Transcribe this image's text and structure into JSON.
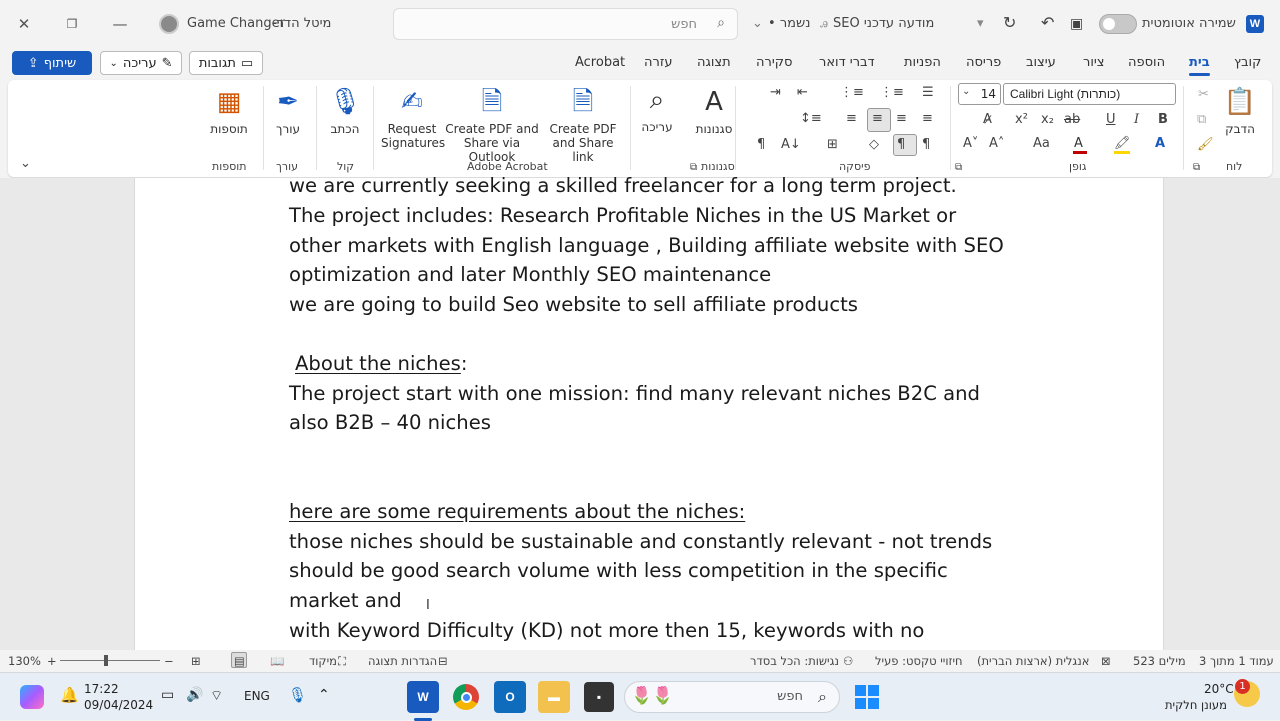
{
  "titlebar": {
    "doc_name": "Game Changer",
    "author": "-מיטל הדר",
    "search_placeholder": "חפש",
    "sensitivity": "SEO מודעה עדכני",
    "saved_state": "• נשמר",
    "autosave_label": "שמירה אוטומטית"
  },
  "actions": {
    "share": "שיתוף",
    "editing": "עריכה",
    "comments": "תגובות"
  },
  "tabs": [
    "קובץ",
    "בית",
    "הוספה",
    "ציור",
    "עיצוב",
    "פריסה",
    "הפניות",
    "דברי דואר",
    "סקירה",
    "תצוגה",
    "עזרה",
    "Acrobat"
  ],
  "active_tab": "בית",
  "ribbon": {
    "groups": {
      "clipboard": "לוח",
      "font": "גופן",
      "paragraph": "פיסקה",
      "styles": "סגנונות",
      "acrobat": "Adobe Acrobat",
      "voice": "קול",
      "editor": "עורך",
      "addins": "תוספות"
    },
    "paste": "הדבק",
    "font_name": "Calibri Light (כותרות)",
    "font_size": "14",
    "styles_btn": "סגנונות",
    "editing_btn": "עריכה",
    "create_pdf_link_1": "Create PDF",
    "create_pdf_link_2": "and Share link",
    "create_pdf_outlook_1": "Create PDF and",
    "create_pdf_outlook_2": "Share via Outlook",
    "request_sig_1": "Request",
    "request_sig_2": "Signatures",
    "dictate": "הכתב",
    "editor_btn": "עורך",
    "addins_btn": "תוספות"
  },
  "document": {
    "line1": "we are currently seeking a skilled freelancer for a long term project.",
    "line2": "The  project includes: Research Profitable Niches in the US Market or",
    "line3": "other markets with English language , Building affiliate  website with SEO",
    "line4": "optimization and later Monthly SEO maintenance",
    "line5": "we are going to build Seo website to sell affiliate products",
    "heading_niches": "About the niches",
    "heading_colon": ":",
    "line6": "The project start with one mission: find many relevant niches B2C and",
    "line7": "also B2B – 40 niches",
    "heading_req": "here are some requirements  about the niches:",
    "line8": "those niches should be sustainable  and constantly relevant - not trends",
    "line9": "should be good search volume with less competition in the specific",
    "line10": "market and",
    "line11": "with Keyword Difficulty (KD) not more then 15, keywords with no"
  },
  "status": {
    "page": "עמוד 1 מתוך 3",
    "words": "523 מילים",
    "language": "אנגלית (ארצות הברית)",
    "predictions": "חיזויי טקסט: פעיל",
    "accessibility": "נגישות: הכל בסדר",
    "display_settings": "הגדרות תצוגה",
    "focus": "מיקוד",
    "zoom": "130%"
  },
  "taskbar": {
    "weather_temp": "20°C",
    "weather_desc": "מעונן חלקית",
    "search": "חפש",
    "lang": "ENG",
    "time": "17:22",
    "date": "09/04/2024",
    "badge": "1"
  },
  "colors": {
    "accent": "#185abd",
    "font_color_red": "#c00000",
    "highlight_yellow": "#ffd700"
  }
}
